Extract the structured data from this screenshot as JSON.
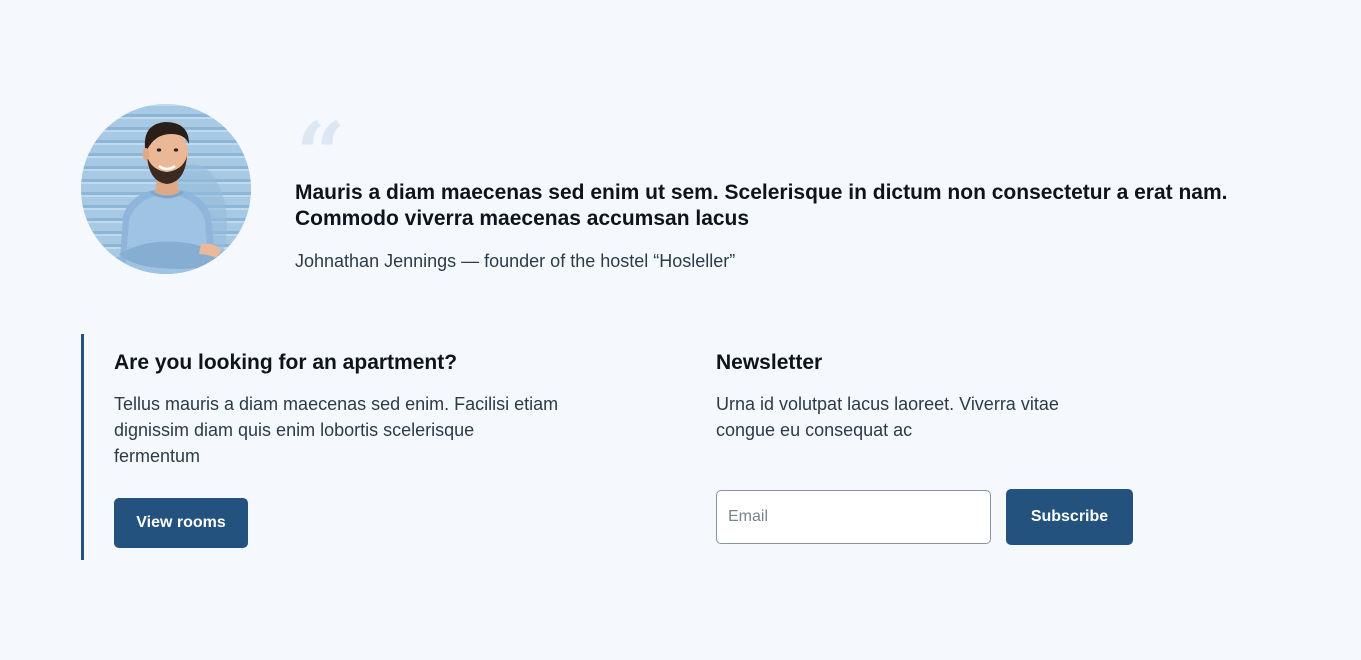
{
  "testimonial": {
    "quote_mark": "“",
    "quote": "Mauris a diam maecenas sed enim ut sem. Scelerisque in dictum non consectetur a erat nam. Commodo viverra maecenas accumsan lacus",
    "author": "Johnathan Jennings — founder of the hostel “Hosleller”",
    "avatar_icon": "person-photo"
  },
  "apartment": {
    "title": "Are you looking for an apartment?",
    "text": "Tellus mauris a diam maecenas sed enim. Facilisi etiam dignissim diam quis enim lobortis scelerisque fermentum",
    "button_label": "View rooms"
  },
  "newsletter": {
    "title": "Newsletter",
    "text": "Urna id volutpat lacus laoreet. Viverra vitae congue eu consequat ac",
    "email_placeholder": "Email",
    "email_value": "",
    "button_label": "Subscribe"
  },
  "colors": {
    "background": "#f5f9fd",
    "accent": "#23527e",
    "quote_mark": "#dde7f3",
    "heading": "#0e141b",
    "body_text": "#2d3a48"
  }
}
